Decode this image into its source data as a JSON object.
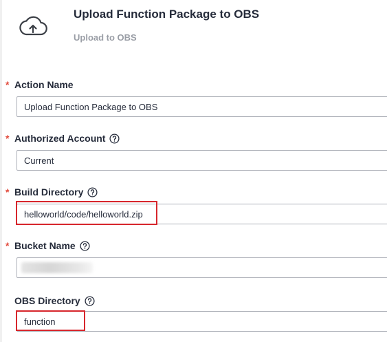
{
  "header": {
    "title": "Upload Function Package to OBS",
    "subtitle": "Upload to OBS",
    "icon": "cloud-upload-icon"
  },
  "form": {
    "action_name": {
      "label": "Action Name",
      "required": true,
      "value": "Upload Function Package to OBS"
    },
    "authorized_account": {
      "label": "Authorized Account",
      "required": true,
      "value": "Current",
      "help_icon": "question-circle-icon"
    },
    "build_directory": {
      "label": "Build Directory",
      "required": true,
      "value": "helloworld/code/helloworld.zip",
      "help_icon": "question-circle-icon",
      "highlighted": true
    },
    "bucket_name": {
      "label": "Bucket Name",
      "required": true,
      "value": "",
      "value_obscured": true,
      "help_icon": "question-circle-icon"
    },
    "obs_directory": {
      "label": "OBS Directory",
      "required": false,
      "value": "function",
      "help_icon": "question-circle-icon",
      "highlighted": true
    }
  },
  "required_marker": "*",
  "colors": {
    "required": "#e24c3e",
    "highlight": "#d7262c",
    "border": "#adb0b8",
    "subtitle": "#9a9ea6"
  }
}
